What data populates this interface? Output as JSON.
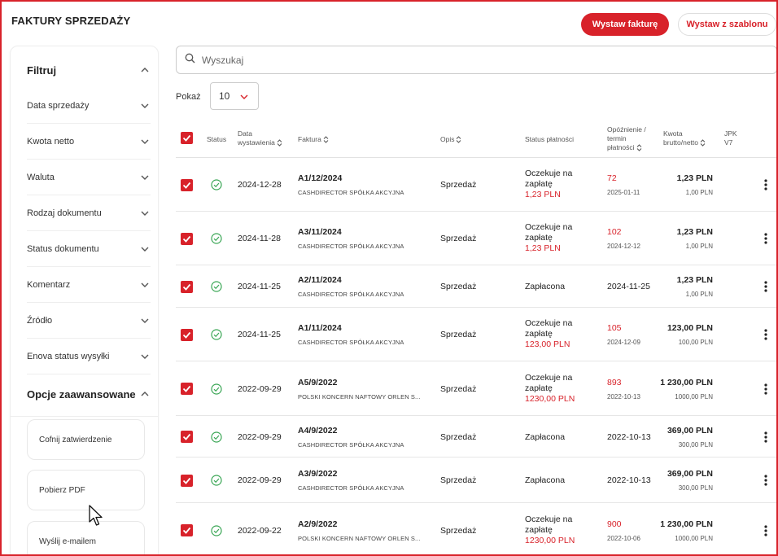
{
  "page": {
    "title": "FAKTURY SPRZEDAŻY",
    "actions": {
      "issue_invoice": "Wystaw fakturę",
      "issue_from_template": "Wystaw z szablonu"
    }
  },
  "sidebar": {
    "filter_title": "Filtruj",
    "filters": [
      {
        "label": "Data sprzedaży"
      },
      {
        "label": "Kwota netto"
      },
      {
        "label": "Waluta"
      },
      {
        "label": "Rodzaj dokumentu"
      },
      {
        "label": "Status dokumentu"
      },
      {
        "label": "Komentarz"
      },
      {
        "label": "Źródło"
      },
      {
        "label": "Enova status wysyłki"
      }
    ],
    "advanced_title": "Opcje zaawansowane",
    "advanced": [
      {
        "label": "Cofnij zatwierdzenie"
      },
      {
        "label": "Pobierz PDF"
      },
      {
        "label": "Wyślij e-mailem"
      }
    ]
  },
  "search": {
    "placeholder": "Wyszukaj",
    "value": ""
  },
  "pagination": {
    "show_label": "Pokaż",
    "page_size": "10"
  },
  "table": {
    "headers": {
      "status": "Status",
      "issue_date_1": "Data",
      "issue_date_2": "wystawienia",
      "invoice": "Faktura",
      "description": "Opis",
      "payment_status": "Status płatności",
      "delay_1": "Opóźnienie /",
      "delay_2": "termin",
      "delay_3": "płatności",
      "amount_1": "Kwota",
      "amount_2": "brutto/netto",
      "jpk_1": "JPK",
      "jpk_2": "V7"
    },
    "rows": [
      {
        "date": "2024-12-28",
        "number": "A1/12/2024",
        "company": "CASHDIRECTOR SPÓŁKA AKCYJNA",
        "desc": "Sprzedaż",
        "pay1": "Oczekuje na",
        "pay2": "zapłatę",
        "pay_amount": "1,23 PLN",
        "delay": "72",
        "due": "2025-01-11",
        "gross": "1,23 PLN",
        "netto": "1,00 PLN",
        "paid": false
      },
      {
        "date": "2024-11-28",
        "number": "A3/11/2024",
        "company": "CASHDIRECTOR SPÓŁKA AKCYJNA",
        "desc": "Sprzedaż",
        "pay1": "Oczekuje na",
        "pay2": "zapłatę",
        "pay_amount": "1,23 PLN",
        "delay": "102",
        "due": "2024-12-12",
        "gross": "1,23 PLN",
        "netto": "1,00 PLN",
        "paid": false
      },
      {
        "date": "2024-11-25",
        "number": "A2/11/2024",
        "company": "CASHDIRECTOR SPÓŁKA AKCYJNA",
        "desc": "Sprzedaż",
        "pay1": "Zapłacona",
        "pay2": "",
        "pay_amount": "",
        "delay": "",
        "due": "2024-11-25",
        "gross": "1,23 PLN",
        "netto": "1,00 PLN",
        "paid": true
      },
      {
        "date": "2024-11-25",
        "number": "A1/11/2024",
        "company": "CASHDIRECTOR SPÓŁKA AKCYJNA",
        "desc": "Sprzedaż",
        "pay1": "Oczekuje na",
        "pay2": "zapłatę",
        "pay_amount": "123,00 PLN",
        "delay": "105",
        "due": "2024-12-09",
        "gross": "123,00 PLN",
        "netto": "100,00 PLN",
        "paid": false
      },
      {
        "date": "2022-09-29",
        "number": "A5/9/2022",
        "company": "POLSKI KONCERN NAFTOWY ORLEN S...",
        "desc": "Sprzedaż",
        "pay1": "Oczekuje na",
        "pay2": "zapłatę",
        "pay_amount": "1230,00 PLN",
        "delay": "893",
        "due": "2022-10-13",
        "gross": "1 230,00 PLN",
        "netto": "1000,00 PLN",
        "paid": false
      },
      {
        "date": "2022-09-29",
        "number": "A4/9/2022",
        "company": "CASHDIRECTOR SPÓŁKA AKCYJNA",
        "desc": "Sprzedaż",
        "pay1": "Zapłacona",
        "pay2": "",
        "pay_amount": "",
        "delay": "",
        "due": "2022-10-13",
        "gross": "369,00 PLN",
        "netto": "300,00 PLN",
        "paid": true
      },
      {
        "date": "2022-09-29",
        "number": "A3/9/2022",
        "company": "CASHDIRECTOR SPÓŁKA AKCYJNA",
        "desc": "Sprzedaż",
        "pay1": "Zapłacona",
        "pay2": "",
        "pay_amount": "",
        "delay": "",
        "due": "2022-10-13",
        "gross": "369,00 PLN",
        "netto": "300,00 PLN",
        "paid": true
      },
      {
        "date": "2022-09-22",
        "number": "A2/9/2022",
        "company": "POLSKI KONCERN NAFTOWY ORLEN S...",
        "desc": "Sprzedaż",
        "pay1": "Oczekuje na",
        "pay2": "zapłatę",
        "pay_amount": "1230,00 PLN",
        "delay": "900",
        "due": "2022-10-06",
        "gross": "1 230,00 PLN",
        "netto": "1000,00 PLN",
        "paid": false
      }
    ]
  },
  "colors": {
    "accent": "#d8222a",
    "status_ok": "#3aa655",
    "text": "#222222",
    "border": "#e6e6e6"
  }
}
